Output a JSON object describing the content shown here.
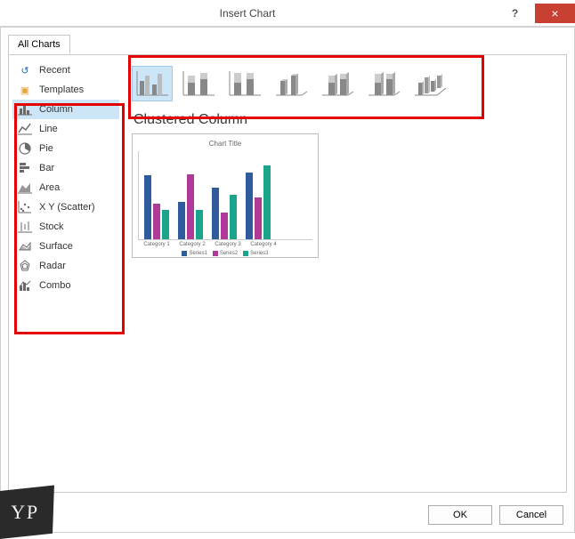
{
  "titlebar": {
    "title": "Insert Chart",
    "help": "?",
    "close": "×"
  },
  "tabs": {
    "allCharts": "All Charts"
  },
  "sidebar": {
    "items": [
      {
        "label": "Recent"
      },
      {
        "label": "Templates"
      },
      {
        "label": "Column"
      },
      {
        "label": "Line"
      },
      {
        "label": "Pie"
      },
      {
        "label": "Bar"
      },
      {
        "label": "Area"
      },
      {
        "label": "X Y (Scatter)"
      },
      {
        "label": "Stock"
      },
      {
        "label": "Surface"
      },
      {
        "label": "Radar"
      },
      {
        "label": "Combo"
      }
    ],
    "selectedIndex": 2
  },
  "subtypes": {
    "names": [
      "Clustered Column",
      "Stacked Column",
      "100% Stacked Column",
      "3-D Clustered Column",
      "3-D Stacked Column",
      "3-D 100% Stacked Column",
      "3-D Column"
    ],
    "selectedIndex": 0
  },
  "chartName": "Clustered Column",
  "preview": {
    "title": "Chart Title",
    "legend": [
      "Series1",
      "Series2",
      "Series3"
    ]
  },
  "footer": {
    "ok": "OK",
    "cancel": "Cancel"
  },
  "chart_data": {
    "type": "bar",
    "categories": [
      "Category 1",
      "Category 2",
      "Category 3",
      "Category 4"
    ],
    "series": [
      {
        "name": "Series1",
        "values": [
          4.3,
          2.5,
          3.5,
          4.5
        ],
        "color": "#2f5b9c"
      },
      {
        "name": "Series2",
        "values": [
          2.4,
          4.4,
          1.8,
          2.8
        ],
        "color": "#b03a97"
      },
      {
        "name": "Series3",
        "values": [
          2.0,
          2.0,
          3.0,
          5.0
        ],
        "color": "#1aa58a"
      }
    ],
    "title": "Chart Title",
    "xlabel": "",
    "ylabel": "",
    "ylim": [
      0,
      6
    ]
  }
}
